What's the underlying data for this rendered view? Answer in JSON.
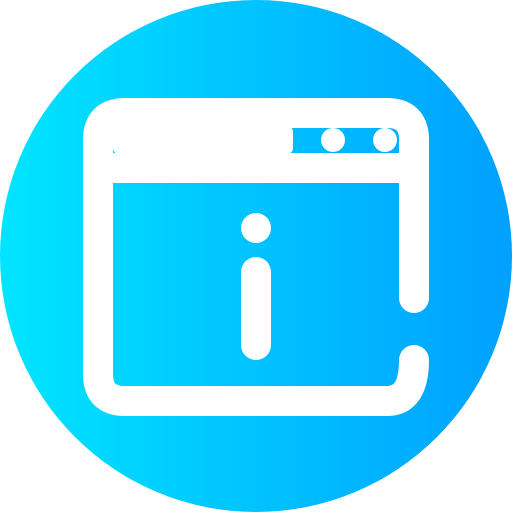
{
  "icon": {
    "name": "browser-window-info-icon",
    "gradient_start": "#00E5FF",
    "gradient_end": "#00A0FF",
    "stroke_color": "#FFFFFF",
    "symbols": [
      "browser-window",
      "window-controls",
      "info-symbol"
    ]
  }
}
